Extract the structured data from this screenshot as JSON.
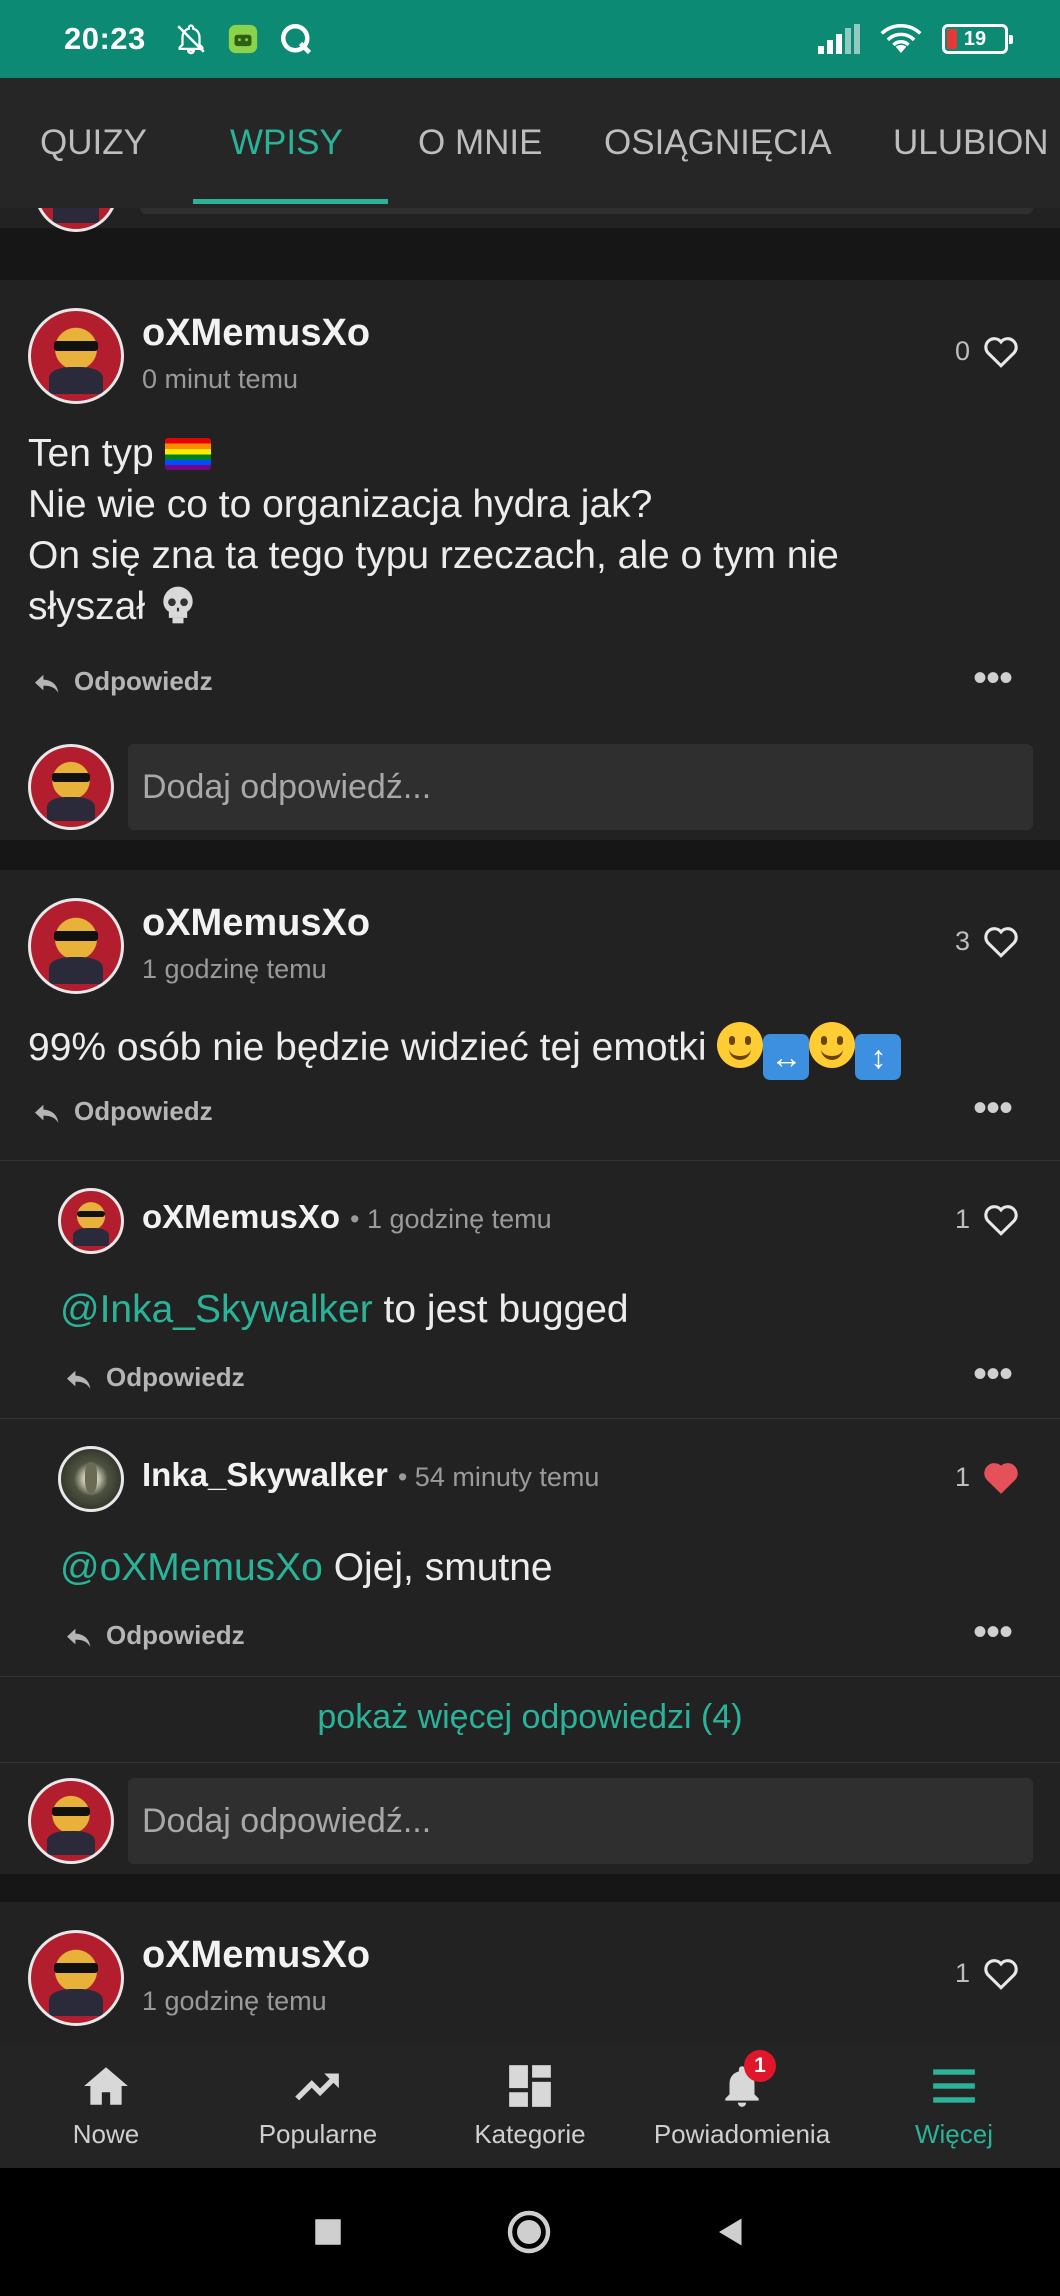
{
  "status_bar": {
    "time": "20:23",
    "battery": "19"
  },
  "tabs": [
    {
      "label": "QUIZY"
    },
    {
      "label": "WPISY"
    },
    {
      "label": "O MNIE"
    },
    {
      "label": "OSIĄGNIĘCIA"
    },
    {
      "label": "ULUBION"
    }
  ],
  "posts": [
    {
      "author": "oXMemusXo",
      "time": "0 minut temu",
      "likes": "0",
      "lines": [
        "Ten typ",
        "Nie wie co to organizacja hydra jak?",
        "On się zna ta tego typu rzeczach, ale o tym nie",
        "słyszał"
      ],
      "reply_label": "Odpowiedz",
      "input_placeholder": "Dodaj odpowiedź..."
    },
    {
      "author": "oXMemusXo",
      "time": "1 godzinę temu",
      "likes": "3",
      "text": "99% osób nie będzie widzieć tej emotki",
      "reply_label": "Odpowiedz",
      "replies": [
        {
          "author": "oXMemusXo",
          "time": "• 1 godzinę temu",
          "likes": "1",
          "liked": false,
          "mention": "@Inka_Skywalker",
          "text": " to jest bugged",
          "reply_label": "Odpowiedz"
        },
        {
          "author": "Inka_Skywalker",
          "time": "• 54 minuty temu",
          "likes": "1",
          "liked": true,
          "mention": "@oXMemusXo",
          "text": " Ojej, smutne",
          "reply_label": "Odpowiedz"
        }
      ],
      "show_more": "pokaż więcej odpowiedzi (4)",
      "input_placeholder": "Dodaj odpowiedź..."
    },
    {
      "author": "oXMemusXo",
      "time": "1 godzinę temu",
      "likes": "1"
    }
  ],
  "bottom_nav": [
    {
      "label": "Nowe",
      "icon": "home-icon"
    },
    {
      "label": "Popularne",
      "icon": "trending-icon"
    },
    {
      "label": "Kategorie",
      "icon": "grid-icon"
    },
    {
      "label": "Powiadomienia",
      "icon": "bell-icon",
      "badge": "1"
    },
    {
      "label": "Więcej",
      "icon": "menu-icon",
      "active": true
    }
  ],
  "colors": {
    "accent": "#2bb39a",
    "status_bar": "#0c8a74",
    "liked_heart": "#e5515a"
  }
}
